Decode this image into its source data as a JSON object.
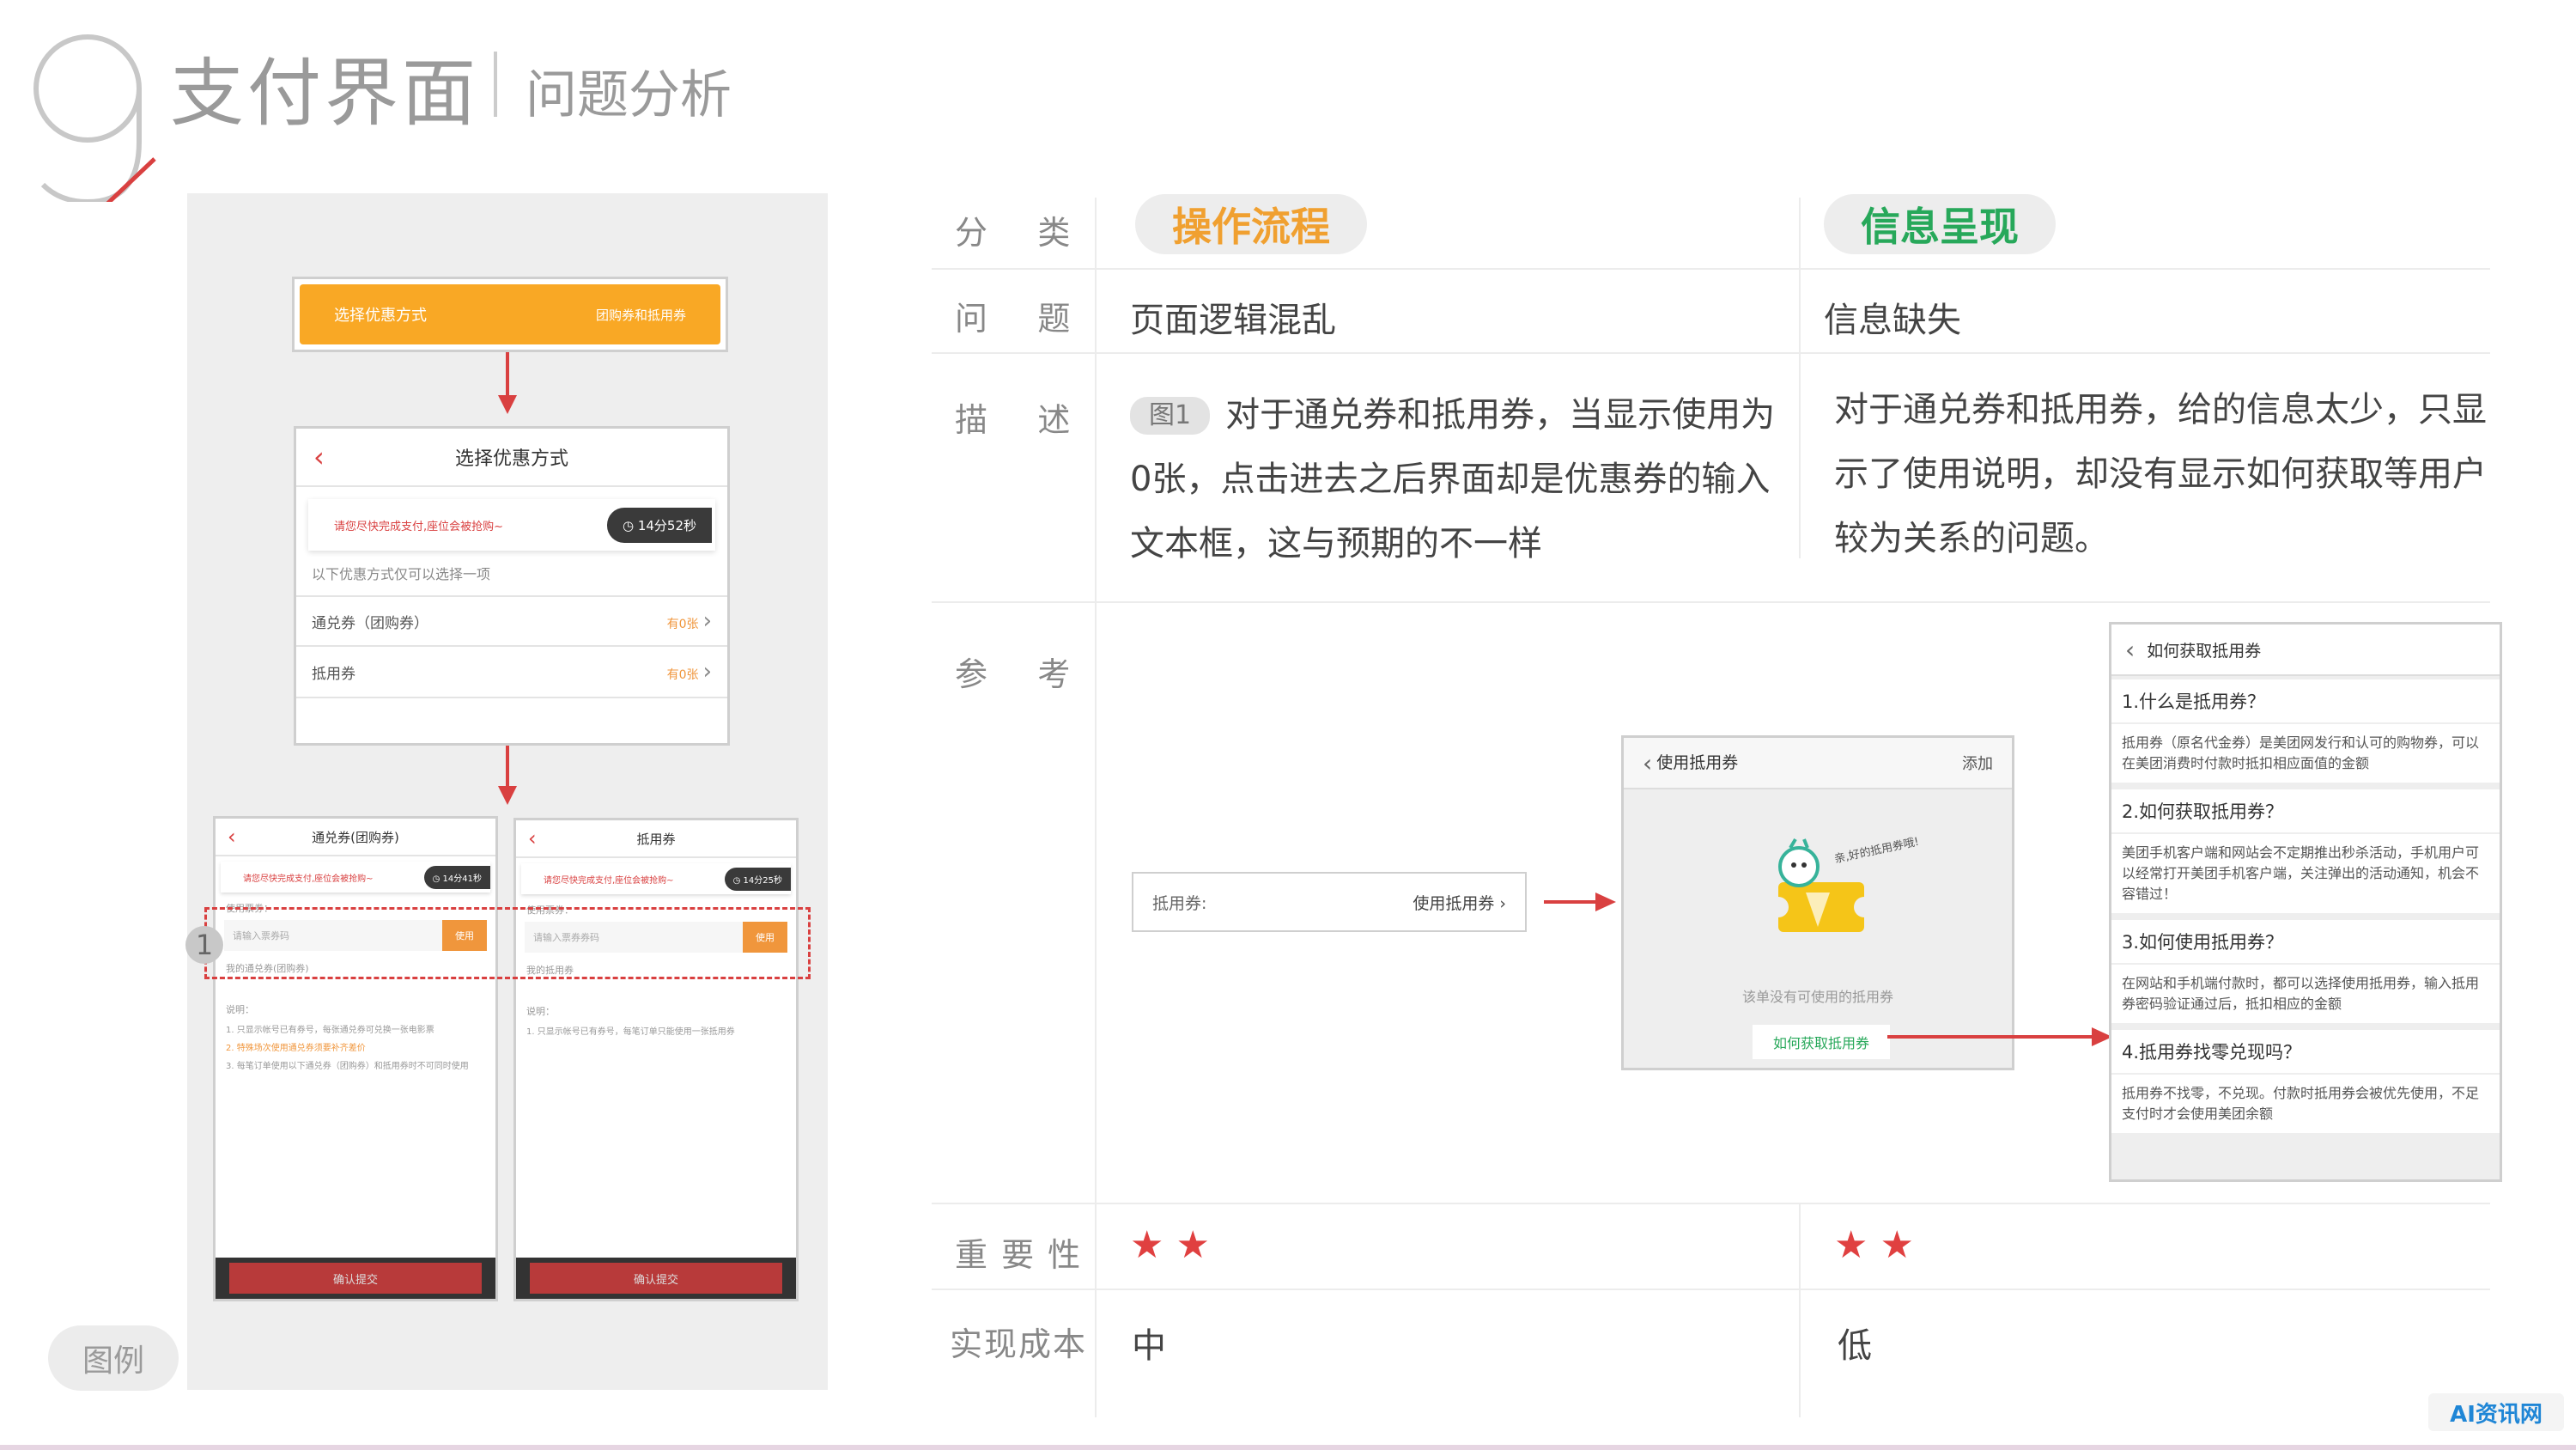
{
  "header": {
    "number": "9",
    "title": "支付界面",
    "subtitle": "问题分析"
  },
  "legend_label": "图例",
  "mock_top": {
    "label": "选择优惠方式",
    "right": "团购券和抵用券"
  },
  "mock_select": {
    "title": "选择优惠方式",
    "notice": "请您尽快完成支付,座位会被抢购~",
    "timer": "14分52秒",
    "hint": "以下优惠方式仅可以选择一项",
    "rows": [
      {
        "label": "通兑券（团购券）",
        "value": "有0张"
      },
      {
        "label": "抵用券",
        "value": "有0张"
      }
    ]
  },
  "mock_left": {
    "title": "通兑券(团购券)",
    "notice": "请您尽快完成支付,座位会被抢购~",
    "timer": "14分41秒",
    "code_label": "使用票券：",
    "placeholder": "请输入票券码",
    "use_btn": "使用",
    "mine": "我的通兑券(团购券)",
    "notes_title": "说明：",
    "notes": [
      "1. 只显示帐号已有券号，每张通兑券可兑换一张电影票",
      "2. 特殊场次使用通兑券须要补齐差价",
      "3. 每笔订单使用以下通兑券（团购券）和抵用券时不可同时使用"
    ],
    "submit": "确认提交"
  },
  "mock_right": {
    "title": "抵用券",
    "notice": "请您尽快完成支付,座位会被抢购~",
    "timer": "14分25秒",
    "code_label": "使用票券：",
    "placeholder": "请输入票券券码",
    "use_btn": "使用",
    "mine": "我的抵用券",
    "notes_title": "说明：",
    "notes": [
      "1. 只显示帐号已有券号，每笔订单只能使用一张抵用券"
    ],
    "submit": "确认提交"
  },
  "marker": "1",
  "table": {
    "labels": {
      "category": "分    类",
      "problem": "问    题",
      "desc": "描    述",
      "ref": "参    考",
      "importance": "重 要 性",
      "cost": "实现成本"
    },
    "col1": {
      "category": "操作流程",
      "category_color": "#f0a030",
      "problem": "页面逻辑混乱",
      "desc_tag": "图1",
      "desc": "对于通兑券和抵用券，当显示使用为0张，点击进去之后界面却是优惠券的输入文本框，这与预期的不一样",
      "importance": "★★",
      "cost": "中"
    },
    "col2": {
      "category": "信息呈现",
      "category_color": "#27a85a",
      "problem": "信息缺失",
      "desc": "对于通兑券和抵用券，给的信息太少，只显示了使用说明，却没有显示如何获取等用户较为关系的问题。",
      "importance": "★★",
      "cost": "低"
    }
  },
  "ref": {
    "row_label": "抵用券:",
    "row_action": "使用抵用券 ›",
    "screen": {
      "title": "使用抵用券",
      "add": "添加",
      "bubble": "亲,好的抵用券哦!",
      "empty": "该单没有可使用的抵用券",
      "link": "如何获取抵用券"
    },
    "faq": {
      "title": "如何获取抵用券",
      "items": [
        {
          "q": "1.什么是抵用券？",
          "a": "抵用券（原名代金券）是美团网发行和认可的购物券，可以在美团消费时付款时抵扣相应面值的金额"
        },
        {
          "q": "2.如何获取抵用券？",
          "a": "美团手机客户端和网站会不定期推出秒杀活动，手机用户可以经常打开美团手机客户端，关注弹出的活动通知，机会不容错过！"
        },
        {
          "q": "3.如何使用抵用券？",
          "a": "在网站和手机端付款时，都可以选择使用抵用券，输入抵用券密码验证通过后，抵扣相应的金额"
        },
        {
          "q": "4.抵用券找零兑现吗？",
          "a": "抵用券不找零，不兑现。付款时抵用券会被优先使用，不足支付时才会使用美团余额"
        }
      ]
    }
  },
  "watermark": "AI资讯网"
}
